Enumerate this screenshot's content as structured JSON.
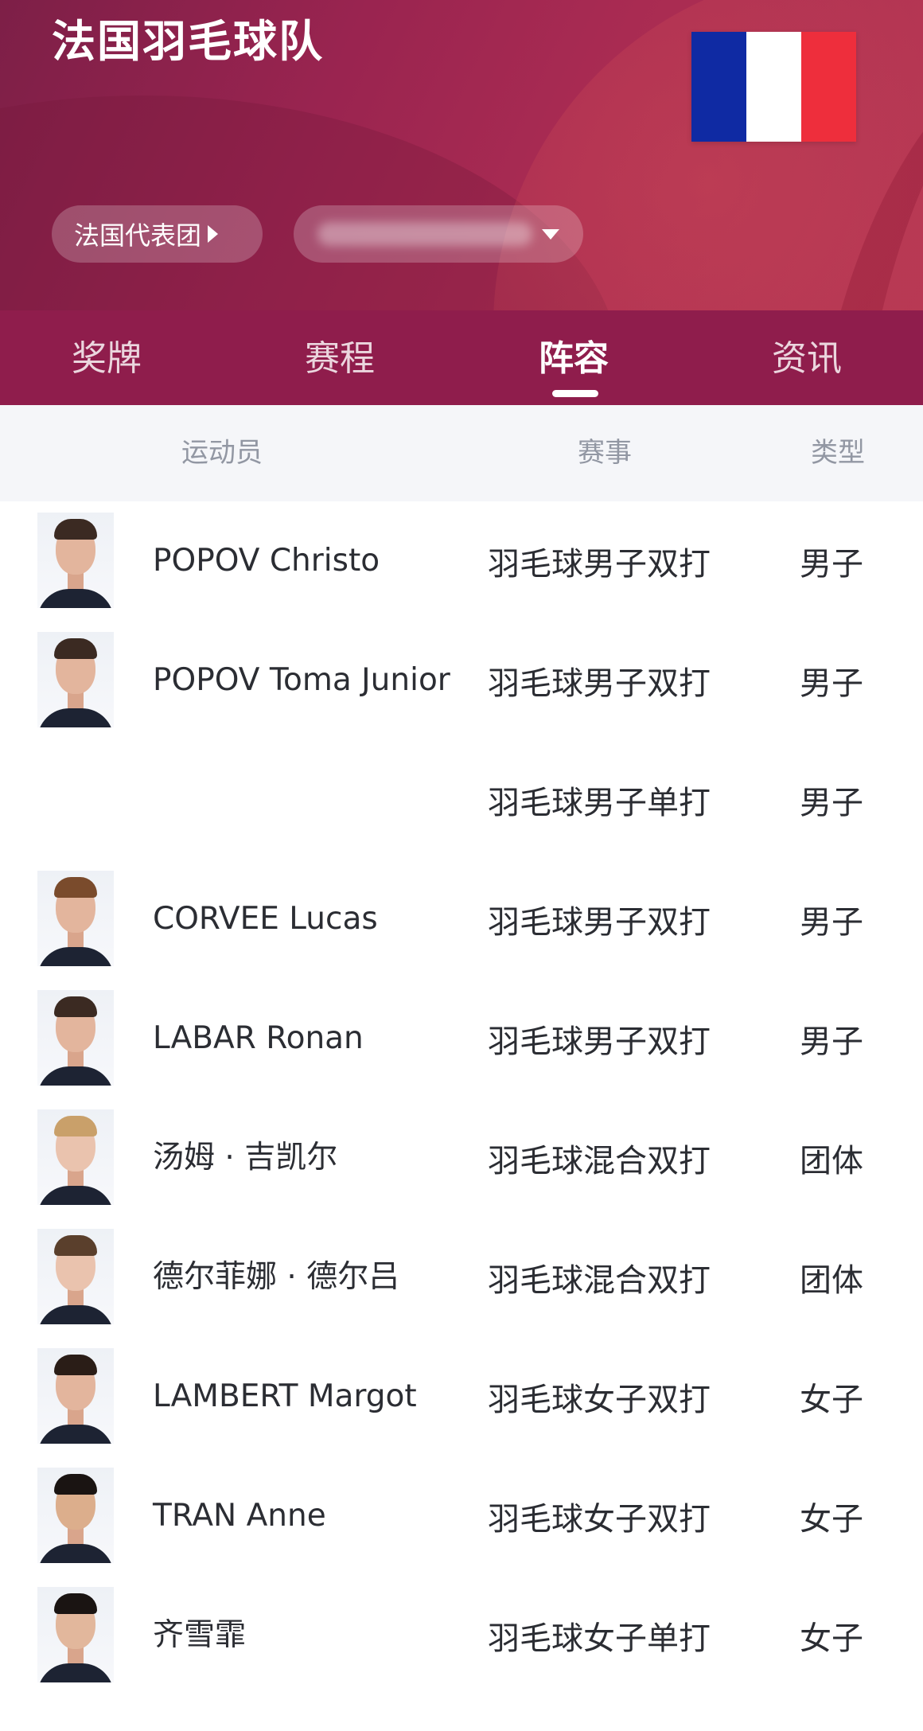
{
  "header": {
    "title": "法国羽毛球队",
    "flag_colors": [
      "#0f2aa3",
      "#ffffff",
      "#ee2e3c"
    ],
    "delegation_chip_label": "法国代表团",
    "delegation_chip_icon": "caret-right-icon",
    "selector_icon": "caret-down-icon"
  },
  "tabs": [
    {
      "label": "奖牌",
      "active": false
    },
    {
      "label": "赛程",
      "active": false
    },
    {
      "label": "阵容",
      "active": true
    },
    {
      "label": "资讯",
      "active": false
    }
  ],
  "table": {
    "columns": {
      "athlete": "运动员",
      "event": "赛事",
      "type": "类型"
    },
    "rows": [
      {
        "name": "POPOV Christo",
        "event": "羽毛球男子双打",
        "type": "男子",
        "has_avatar": true
      },
      {
        "name": "POPOV Toma Junior",
        "event": "羽毛球男子双打",
        "type": "男子",
        "has_avatar": true
      },
      {
        "name": "",
        "event": "羽毛球男子单打",
        "type": "男子",
        "has_avatar": false
      },
      {
        "name": "CORVEE Lucas",
        "event": "羽毛球男子双打",
        "type": "男子",
        "has_avatar": true
      },
      {
        "name": "LABAR Ronan",
        "event": "羽毛球男子双打",
        "type": "男子",
        "has_avatar": true
      },
      {
        "name": "汤姆 · 吉凯尔",
        "event": "羽毛球混合双打",
        "type": "团体",
        "has_avatar": true
      },
      {
        "name": "德尔菲娜 · 德尔吕",
        "event": "羽毛球混合双打",
        "type": "团体",
        "has_avatar": true
      },
      {
        "name": "LAMBERT Margot",
        "event": "羽毛球女子双打",
        "type": "女子",
        "has_avatar": true
      },
      {
        "name": "TRAN Anne",
        "event": "羽毛球女子双打",
        "type": "女子",
        "has_avatar": true
      },
      {
        "name": "齐雪霏",
        "event": "羽毛球女子单打",
        "type": "女子",
        "has_avatar": true
      }
    ]
  },
  "colors": {
    "header_accent": "#9a2450",
    "tabbar": "#8f1d4c",
    "table_header_bg": "#f5f6f9"
  }
}
